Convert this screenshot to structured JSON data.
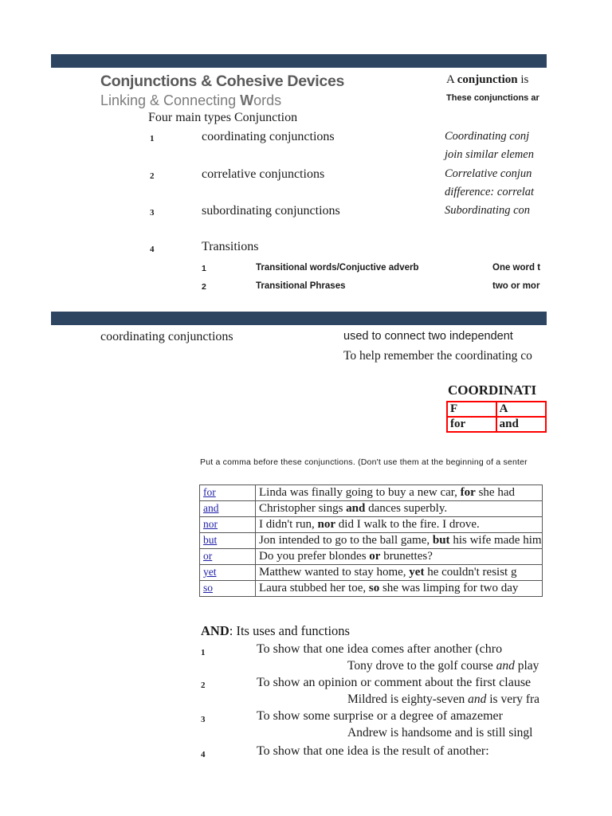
{
  "document": {
    "title_main": "Conjunctions & Cohesive Devices",
    "subtitle_plain_1": "Linking & Connecting ",
    "subtitle_bold": "W",
    "subtitle_plain_2": "ords",
    "definition_lead": "A ",
    "definition_bold": "conjunction",
    "definition_tail": " is",
    "these_conjunctions_line": "These conjunctions ar",
    "four_types_heading": "Four main types Conjunction"
  },
  "types_list": [
    {
      "num": "1",
      "label": "coordinating conjunctions",
      "desc_line1": "Coordinating conj",
      "desc_line2": "join similar elemen"
    },
    {
      "num": "2",
      "label": "correlative conjunctions",
      "desc_line1": "Correlative conjun",
      "desc_line2": "difference: correlat"
    },
    {
      "num": "3",
      "label": "subordinating conjunctions",
      "desc_line1": "Subordinating con",
      "desc_line2": ""
    },
    {
      "num": "4",
      "label": "Transitions",
      "desc_line1": "",
      "desc_line2": ""
    }
  ],
  "transitions_sub": [
    {
      "num": "1",
      "label": "Transitional words/Conjuctive adverb",
      "desc": "One word t"
    },
    {
      "num": "2",
      "label": "Transitional Phrases",
      "desc": "two or mor"
    }
  ],
  "section2": {
    "label": "coordinating conjunctions",
    "desc_line1": "used to connect two independent",
    "desc_line2": "To help remember the coordinating co"
  },
  "fanboys": {
    "title": "COORDINATI",
    "header_cells": [
      "F",
      "A"
    ],
    "word_cells": [
      "for",
      "and"
    ]
  },
  "comma_note": "Put a comma before these conjunctions.  (Don't use them at the beginning of a senter",
  "examples": {
    "rows": [
      {
        "word": "for",
        "sentence_pre": "Linda was finally going to buy a new car, ",
        "sentence_bold": "for",
        "sentence_post": " she had "
      },
      {
        "word": "and",
        "sentence_pre": "Christopher sings ",
        "sentence_bold": "and",
        "sentence_post": " dances superbly."
      },
      {
        "word": "nor",
        "sentence_pre": "I didn't run, ",
        "sentence_bold": "nor",
        "sentence_post": " did I walk to the fire.  I drove."
      },
      {
        "word": "but",
        "sentence_pre": "Jon intended to go to the ball game, ",
        "sentence_bold": "but",
        "sentence_post": " his wife made him "
      },
      {
        "word": "or",
        "sentence_pre": "Do you prefer blondes ",
        "sentence_bold": "or",
        "sentence_post": " brunettes?"
      },
      {
        "word": "yet",
        "sentence_pre": "Matthew wanted to stay home, ",
        "sentence_bold": "yet",
        "sentence_post": " he couldn't resist g"
      },
      {
        "word": "so",
        "sentence_pre": "Laura stubbed her toe, ",
        "sentence_bold": "so",
        "sentence_post": " she was limping for two day"
      }
    ]
  },
  "and_section": {
    "heading_bold": "AND",
    "heading_rest": ": Its uses and functions",
    "items": [
      {
        "num": "1",
        "text": "To show that one idea comes after another (chro",
        "example_pre": "Tony drove to the golf course ",
        "example_italic": "and",
        "example_post": " play"
      },
      {
        "num": "2",
        "text": "To show an opinion or comment about the first clause",
        "example_pre": "Mildred is eighty-seven ",
        "example_italic": "and",
        "example_post": " is very fra"
      },
      {
        "num": "3",
        "text": "To show some surprise or a degree of amazemer",
        "example_pre": "Andrew is handsome and is still singl",
        "example_italic": "",
        "example_post": ""
      },
      {
        "num": "4",
        "text": "To show that one idea is the result of another:",
        "example_pre": "",
        "example_italic": "",
        "example_post": ""
      }
    ]
  },
  "colors": {
    "header_bar": "#2e4561",
    "table_border_red": "#ff0000",
    "link_blue": "#2020a8",
    "title_gray": "#5a5a5a",
    "subtitle_gray": "#7d7d7d"
  }
}
